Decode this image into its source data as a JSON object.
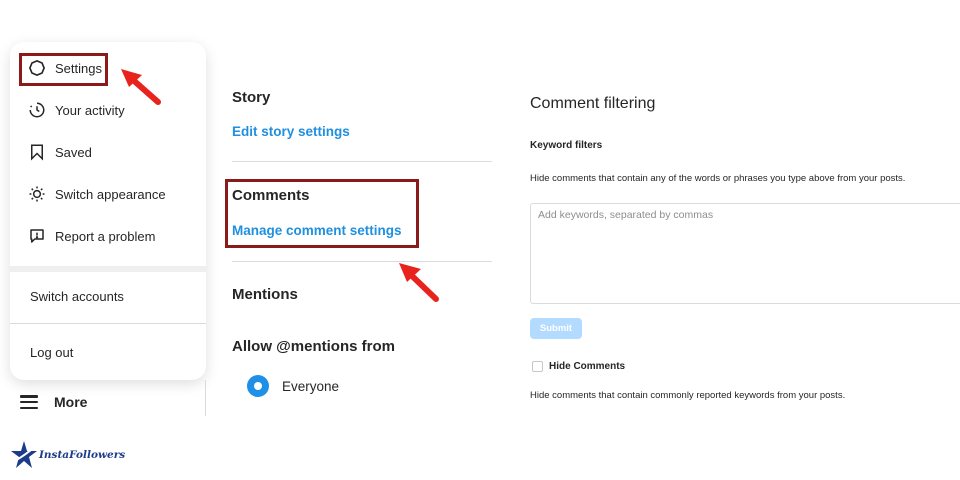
{
  "menu": {
    "items": [
      {
        "label": "Settings",
        "icon": "settings-icon"
      },
      {
        "label": "Your activity",
        "icon": "activity-icon"
      },
      {
        "label": "Saved",
        "icon": "bookmark-icon"
      },
      {
        "label": "Switch appearance",
        "icon": "sun-icon"
      },
      {
        "label": "Report a problem",
        "icon": "report-icon"
      }
    ],
    "switch_accounts": "Switch accounts",
    "log_out": "Log out"
  },
  "nav": {
    "more_label": "More"
  },
  "settings": {
    "story_title": "Story",
    "story_link": "Edit story settings",
    "comments_title": "Comments",
    "comments_link": "Manage comment settings",
    "mentions_title": "Mentions",
    "allow_mentions_title": "Allow @mentions from",
    "selected_option": "Everyone"
  },
  "comment_filtering": {
    "title": "Comment filtering",
    "keyword_filters_label": "Keyword filters",
    "keyword_description": "Hide comments that contain any of the words or phrases you type above from your posts.",
    "keywords_placeholder": "Add keywords, separated by commas",
    "keywords_value": "",
    "submit_label": "Submit",
    "hide_comments_label": "Hide Comments",
    "hide_comments_checked": false,
    "hide_comments_description": "Hide comments that contain commonly reported keywords from your posts."
  },
  "annotations": {
    "highlight_color": "#8b1a1a",
    "arrow_color": "#e8231e"
  },
  "colors": {
    "link": "#1f8fe0",
    "radio": "#1e90e8",
    "submit_disabled": "#b3dbff"
  },
  "watermark": {
    "text": "InstaFollowers"
  }
}
